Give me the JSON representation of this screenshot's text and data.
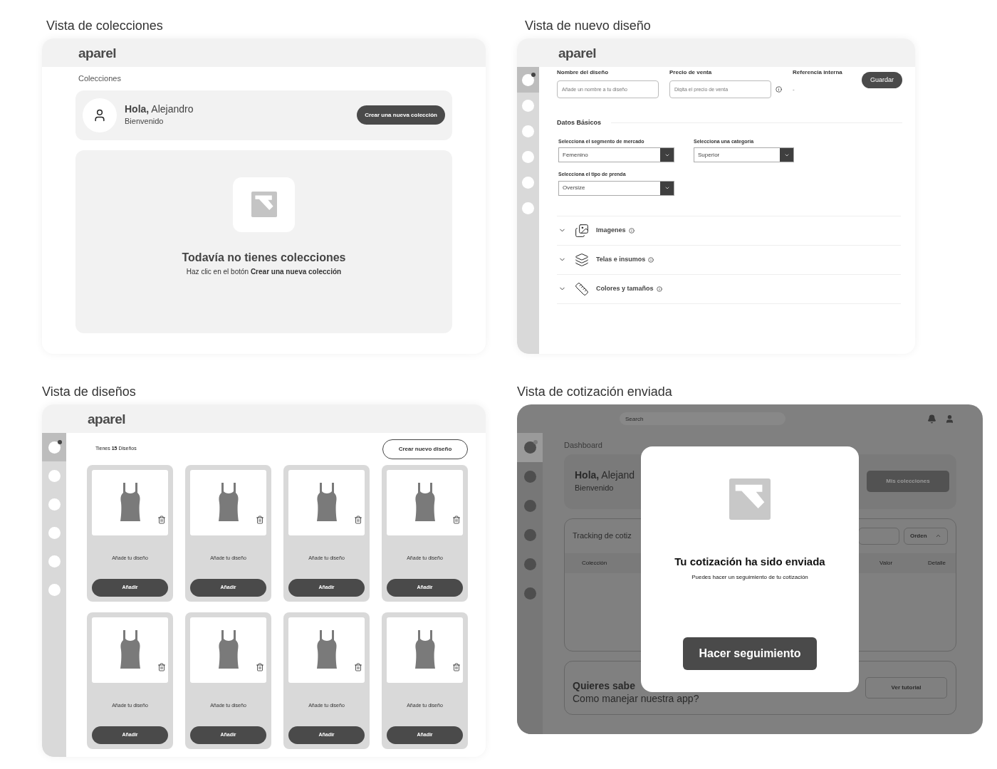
{
  "collections_view": {
    "caption": "Vista de colecciones",
    "logo": "aparel",
    "breadcrumb": "Colecciones",
    "greeting": "**Hola,** Alejandro",
    "subtitle": "Bienvenido",
    "create_button": "Crear una nueva colección",
    "empty_title": "Todavía no tienes colecciones",
    "empty_text": "Haz clic en el botón **Crear una nueva colección**"
  },
  "new_design_view": {
    "caption": "Vista de nuevo diseño",
    "logo": "aparel",
    "sidebar": [
      {
        "selected": true
      },
      {
        "selected": false
      },
      {
        "selected": false
      },
      {
        "selected": false
      },
      {
        "selected": false
      },
      {
        "selected": false
      }
    ],
    "fields": [
      {
        "label": "Nombre del diseño",
        "placeholder": "Añade un nombre a tu diseño"
      },
      {
        "label": "Precio de venta",
        "placeholder": "Digita el precio de venta"
      }
    ],
    "reference_label": "Referencia interna",
    "reference_value": "-",
    "save_button": "Guardar",
    "section_title": "Datos Básicos",
    "selects": [
      {
        "label": "Selecciona el segmento de mercado",
        "value": "Femenino"
      },
      {
        "label": "Selecciona una categoría",
        "value": "Superior"
      },
      {
        "label": "Selecciona el tipo de prenda",
        "value": "Oversize"
      }
    ],
    "accordion": [
      {
        "kind": "images",
        "label": "Imagenes",
        "expanded": false
      },
      {
        "kind": "fabrics",
        "label": "Telas e insumos",
        "expanded": false
      },
      {
        "kind": "measure",
        "label": "Colores y tamaños",
        "expanded": false
      }
    ]
  },
  "designs_view": {
    "caption": "Vista de diseños",
    "logo": "aparel",
    "sidebar": [
      {
        "selected": true
      },
      {
        "selected": false
      },
      {
        "selected": false
      },
      {
        "selected": false
      },
      {
        "selected": false
      },
      {
        "selected": false
      }
    ],
    "count": "Tienes **15** Diseños",
    "create_button": "Crear nuevo diseño",
    "cards": [
      {
        "text": "Añade tu diseño",
        "button": "Añadir"
      },
      {
        "text": "Añade tu diseño",
        "button": "Añadir"
      },
      {
        "text": "Añade tu diseño",
        "button": "Añadir"
      },
      {
        "text": "Añade tu diseño",
        "button": "Añadir"
      },
      {
        "text": "Añade tu diseño",
        "button": "Añadir"
      },
      {
        "text": "Añade tu diseño",
        "button": "Añadir"
      },
      {
        "text": "Añade tu diseño",
        "button": "Añadir"
      },
      {
        "text": "Añade tu diseño",
        "button": "Añadir"
      }
    ]
  },
  "quote_sent_view": {
    "caption": "Vista de cotización enviada",
    "search_placeholder": "Search",
    "sidebar": [
      {
        "selected": true
      },
      {
        "selected": false
      },
      {
        "selected": false
      },
      {
        "selected": false
      },
      {
        "selected": false
      },
      {
        "selected": false
      }
    ],
    "title": "Dashboard",
    "greeting": "**Hola,** Alejand",
    "subtitle": "Bienvenido",
    "collections_button": "Mis colecciones",
    "tracking_title": "Tracking de cotiz",
    "sort_button": "Orden",
    "columns": [
      "Colección",
      "Valor",
      "Detalle"
    ],
    "help_title": "Quieres sabe",
    "help_text": "Como manejar nuestra app?",
    "tutorial_button": "Ver tutorial",
    "modal": {
      "title": "Tu cotización ha sido enviada",
      "text": "Puedes hacer un seguimiento de tu cotización",
      "button": "Hacer seguimiento"
    }
  }
}
